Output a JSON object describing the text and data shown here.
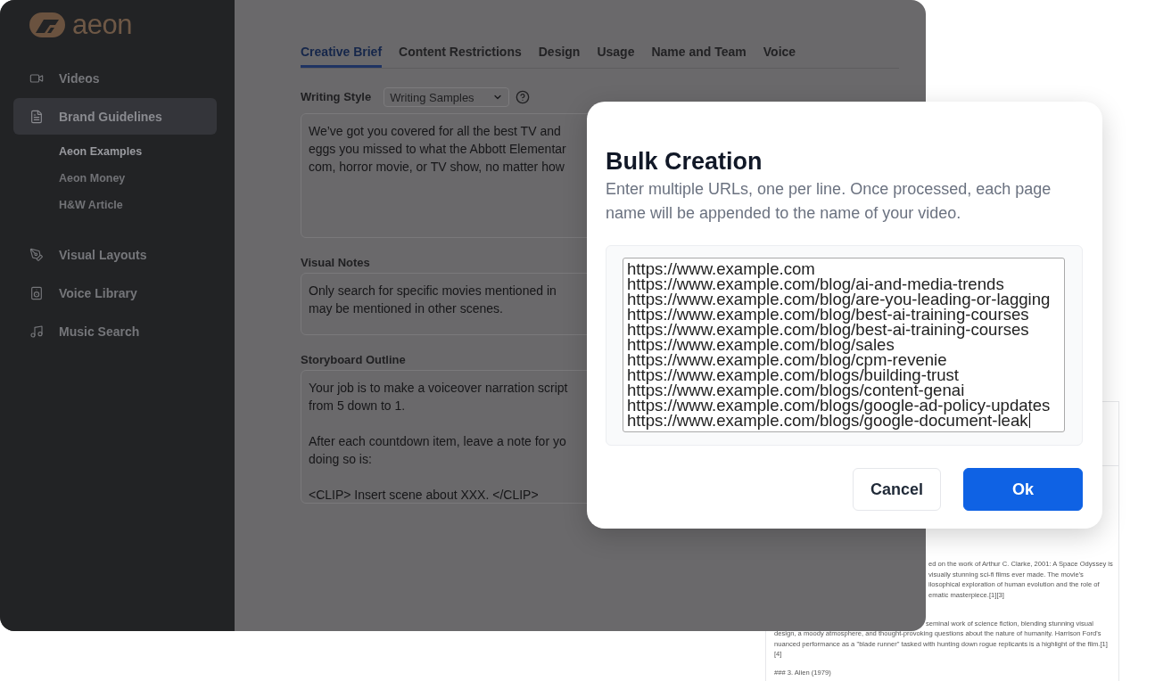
{
  "sidebar": {
    "logo": "aeon",
    "items": [
      {
        "label": "Videos",
        "selected": false
      },
      {
        "label": "Brand Guidelines",
        "selected": true,
        "children": [
          {
            "label": "Aeon Examples",
            "selected": true
          },
          {
            "label": "Aeon Money",
            "selected": false
          },
          {
            "label": "H&W Article",
            "selected": false
          }
        ]
      },
      {
        "label": "Visual Layouts",
        "selected": false
      },
      {
        "label": "Voice Library",
        "selected": false
      },
      {
        "label": "Music Search",
        "selected": false
      }
    ]
  },
  "tabs": [
    {
      "label": "Creative Brief",
      "selected": true
    },
    {
      "label": "Content Restrictions",
      "selected": false
    },
    {
      "label": "Design",
      "selected": false
    },
    {
      "label": "Usage",
      "selected": false
    },
    {
      "label": "Name and Team",
      "selected": false
    },
    {
      "label": "Voice",
      "selected": false
    }
  ],
  "form": {
    "fields": [
      {
        "label": "Writing Style",
        "select": "Writing Samples",
        "paragraphs": [
          {
            "lines": [
              "We’ve got you covered for all the best TV and",
              "eggs you missed to what the Abbott Elementar",
              "com, horror movie, or TV show, no matter how"
            ]
          }
        ]
      },
      {
        "label": "Visual Notes",
        "paragraphs": [
          {
            "lines": [
              "Only search for specific movies mentioned in",
              "may be mentioned in other scenes."
            ]
          }
        ]
      },
      {
        "label": "Storyboard Outline",
        "paragraphs": [
          {
            "lines": [
              "Your job is to make a voiceover narration script",
              "from 5 down to 1."
            ]
          },
          {
            "lines": [
              "After each countdown item, leave a note for yo",
              "doing so is:"
            ]
          },
          {
            "lines": [
              "<CLIP> Insert scene about XXX. </CLIP>"
            ]
          }
        ]
      }
    ]
  },
  "document": {
    "paragraphs": [
      {
        "lines": [
          "ed on the work of Arthur C. Clarke, 2001: A Space Odyssey is",
          "visually stunning sci-fi films ever made. The movie's",
          "ilosophical exploration of human evolution and the role of",
          "ematic masterpiece.[1][3]"
        ]
      },
      {
        "lines": [
          "seminal work of science fiction, blending stunning visual",
          "design, a moody atmosphere, and thought-provoking questions about the nature of humanity. Harrison Ford's",
          "nuanced performance as a \"blade runner\" tasked with hunting down rogue replicants is a highlight of the film.[1]",
          "[4]"
        ]
      },
      {
        "lines": [
          "### 3. Alien (1979)"
        ]
      }
    ]
  },
  "modal": {
    "title": "Bulk Creation",
    "description": "Enter multiple URLs, one per line. Once processed, each page name will be appended to the name of your video.",
    "url_field": {
      "focused": true,
      "lines": [
        "https://www.example.com",
        "https://www.example.com/blog/ai-and-media-trends",
        "https://www.example.com/blog/are-you-leading-or-lagging",
        "https://www.example.com/blog/best-ai-training-courses",
        "https://www.example.com/blog/best-ai-training-courses",
        "https://www.example.com/blog/sales",
        "https://www.example.com/blog/cpm-revenie",
        "https://www.example.com/blogs/building-trust",
        "https://www.example.com/blogs/content-genai",
        "https://www.example.com/blogs/google-ad-policy-updates",
        "https://www.example.com/blogs/google-document-leak"
      ]
    },
    "buttons": [
      {
        "label": "Cancel",
        "kind": "secondary"
      },
      {
        "label": "Ok",
        "kind": "primary"
      }
    ]
  }
}
